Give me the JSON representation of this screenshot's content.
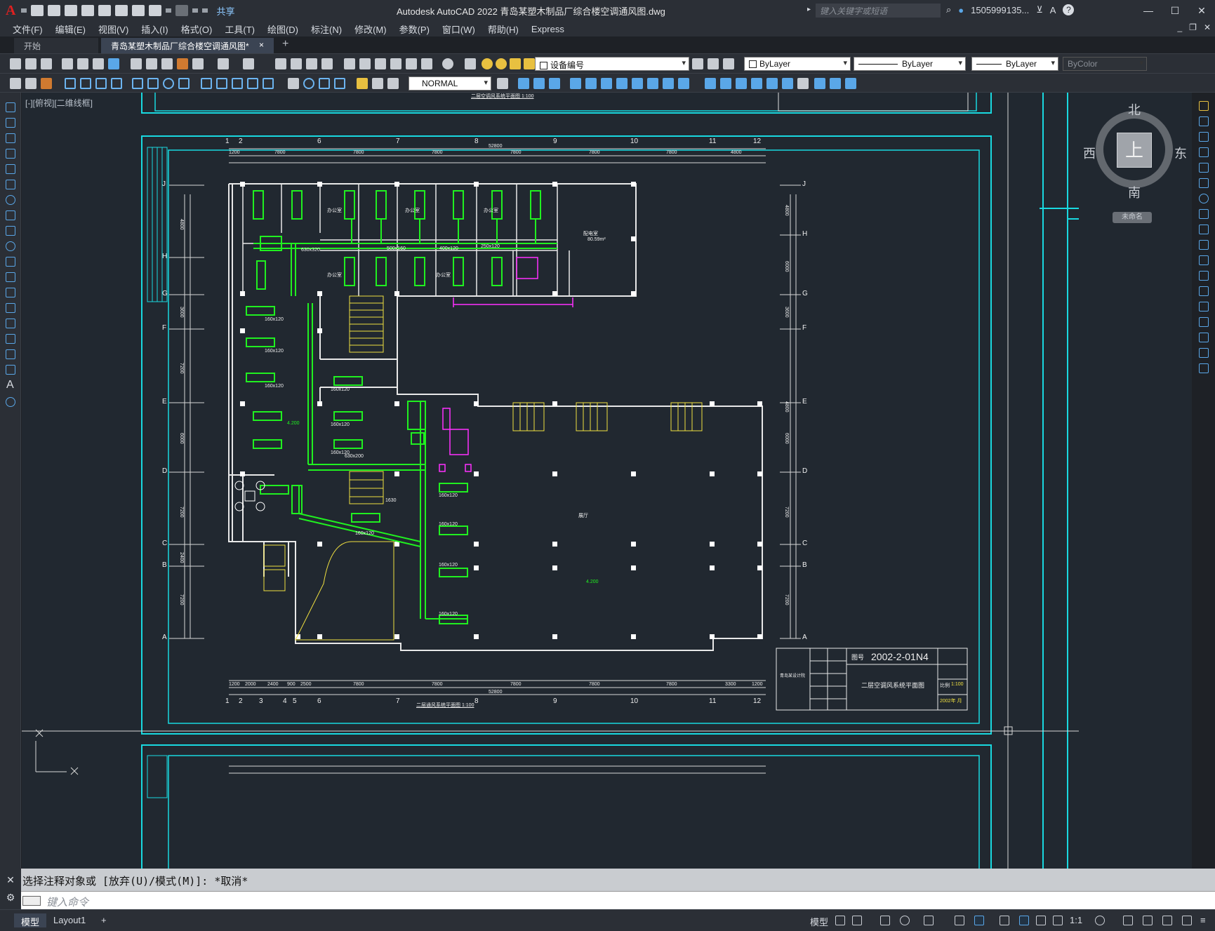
{
  "app": {
    "logo": "A",
    "window_title": "Autodesk AutoCAD 2022    青岛某塑木制品厂综合楼空调通风图.dwg",
    "share_label": "共享",
    "search_placeholder": "键入关键字或短语",
    "user_label": "1505999135...",
    "help_label": "?"
  },
  "menu": [
    "文件(F)",
    "编辑(E)",
    "视图(V)",
    "插入(I)",
    "格式(O)",
    "工具(T)",
    "绘图(D)",
    "标注(N)",
    "修改(M)",
    "参数(P)",
    "窗口(W)",
    "帮助(H)",
    "Express"
  ],
  "tabs": {
    "start": "开始",
    "active": "青岛某塑木制品厂综合楼空调通风图*",
    "close": "×",
    "add": "+"
  },
  "toolbar": {
    "layer_name": "设备编号",
    "color_combo": "ByLayer",
    "linetype_combo": "ByLayer",
    "lineweight_combo": "ByLayer",
    "plotstyle_combo": "ByColor",
    "dimstyle_combo": "NORMAL"
  },
  "viewport": {
    "label": "[-][俯视][二维线框]",
    "viewcube": {
      "north": "北",
      "south": "南",
      "west": "西",
      "east": "东",
      "face": "上"
    },
    "wcs_label": "未命名"
  },
  "drawing": {
    "grid_top": [
      "1",
      "2",
      "6",
      "7",
      "8",
      "9",
      "10",
      "11",
      "12"
    ],
    "grid_bottom": [
      "1",
      "2",
      "3",
      "4",
      "5",
      "6",
      "7",
      "8",
      "9",
      "10",
      "11",
      "12"
    ],
    "grid_side": [
      "J",
      "H",
      "G",
      "F",
      "E",
      "D",
      "C",
      "B",
      "A"
    ],
    "dims_top": [
      "1200",
      "7800",
      "7800",
      "7800",
      "7800",
      "7800",
      "7800",
      "7800",
      "4800"
    ],
    "overall_dim": "52800",
    "dims_bottom": [
      "1200",
      "2000",
      "2400",
      "900",
      "2500",
      "7800",
      "7800",
      "7800",
      "7800",
      "7800",
      "3300",
      "1200"
    ],
    "side_dims": [
      "4800",
      "6000",
      "3600",
      "7200",
      "4800",
      "6000",
      "7200",
      "2400",
      "7200"
    ],
    "top_title": "二层空调风系统平面图 1:100",
    "plan_title": "二层通风系统平面图 1:100",
    "room_label": "配电室",
    "room_area": "80.59m²",
    "hall_label": "展厅",
    "elevation": "4.200",
    "duct_labels": [
      "630x320",
      "500x160",
      "400x120",
      "250x120",
      "160x120",
      "630x200",
      "1630"
    ],
    "room_office": "办公室",
    "title_block": {
      "drawing_no_label": "图号",
      "drawing_no": "2002-2-01N4",
      "drawing_name": "二层空调风系统平面图",
      "scale_label": "比例",
      "scale": "1:100",
      "date": "2002年 月",
      "company": "青岛某设计院"
    }
  },
  "command": {
    "history": "选择注释对象或 [放弃(U)/模式(M)]: *取消*",
    "placeholder": "键入命令"
  },
  "status": {
    "model_tab": "模型",
    "layout_tab": "Layout1",
    "add_tab": "+",
    "model_label": "模型",
    "scale": "1:1"
  }
}
